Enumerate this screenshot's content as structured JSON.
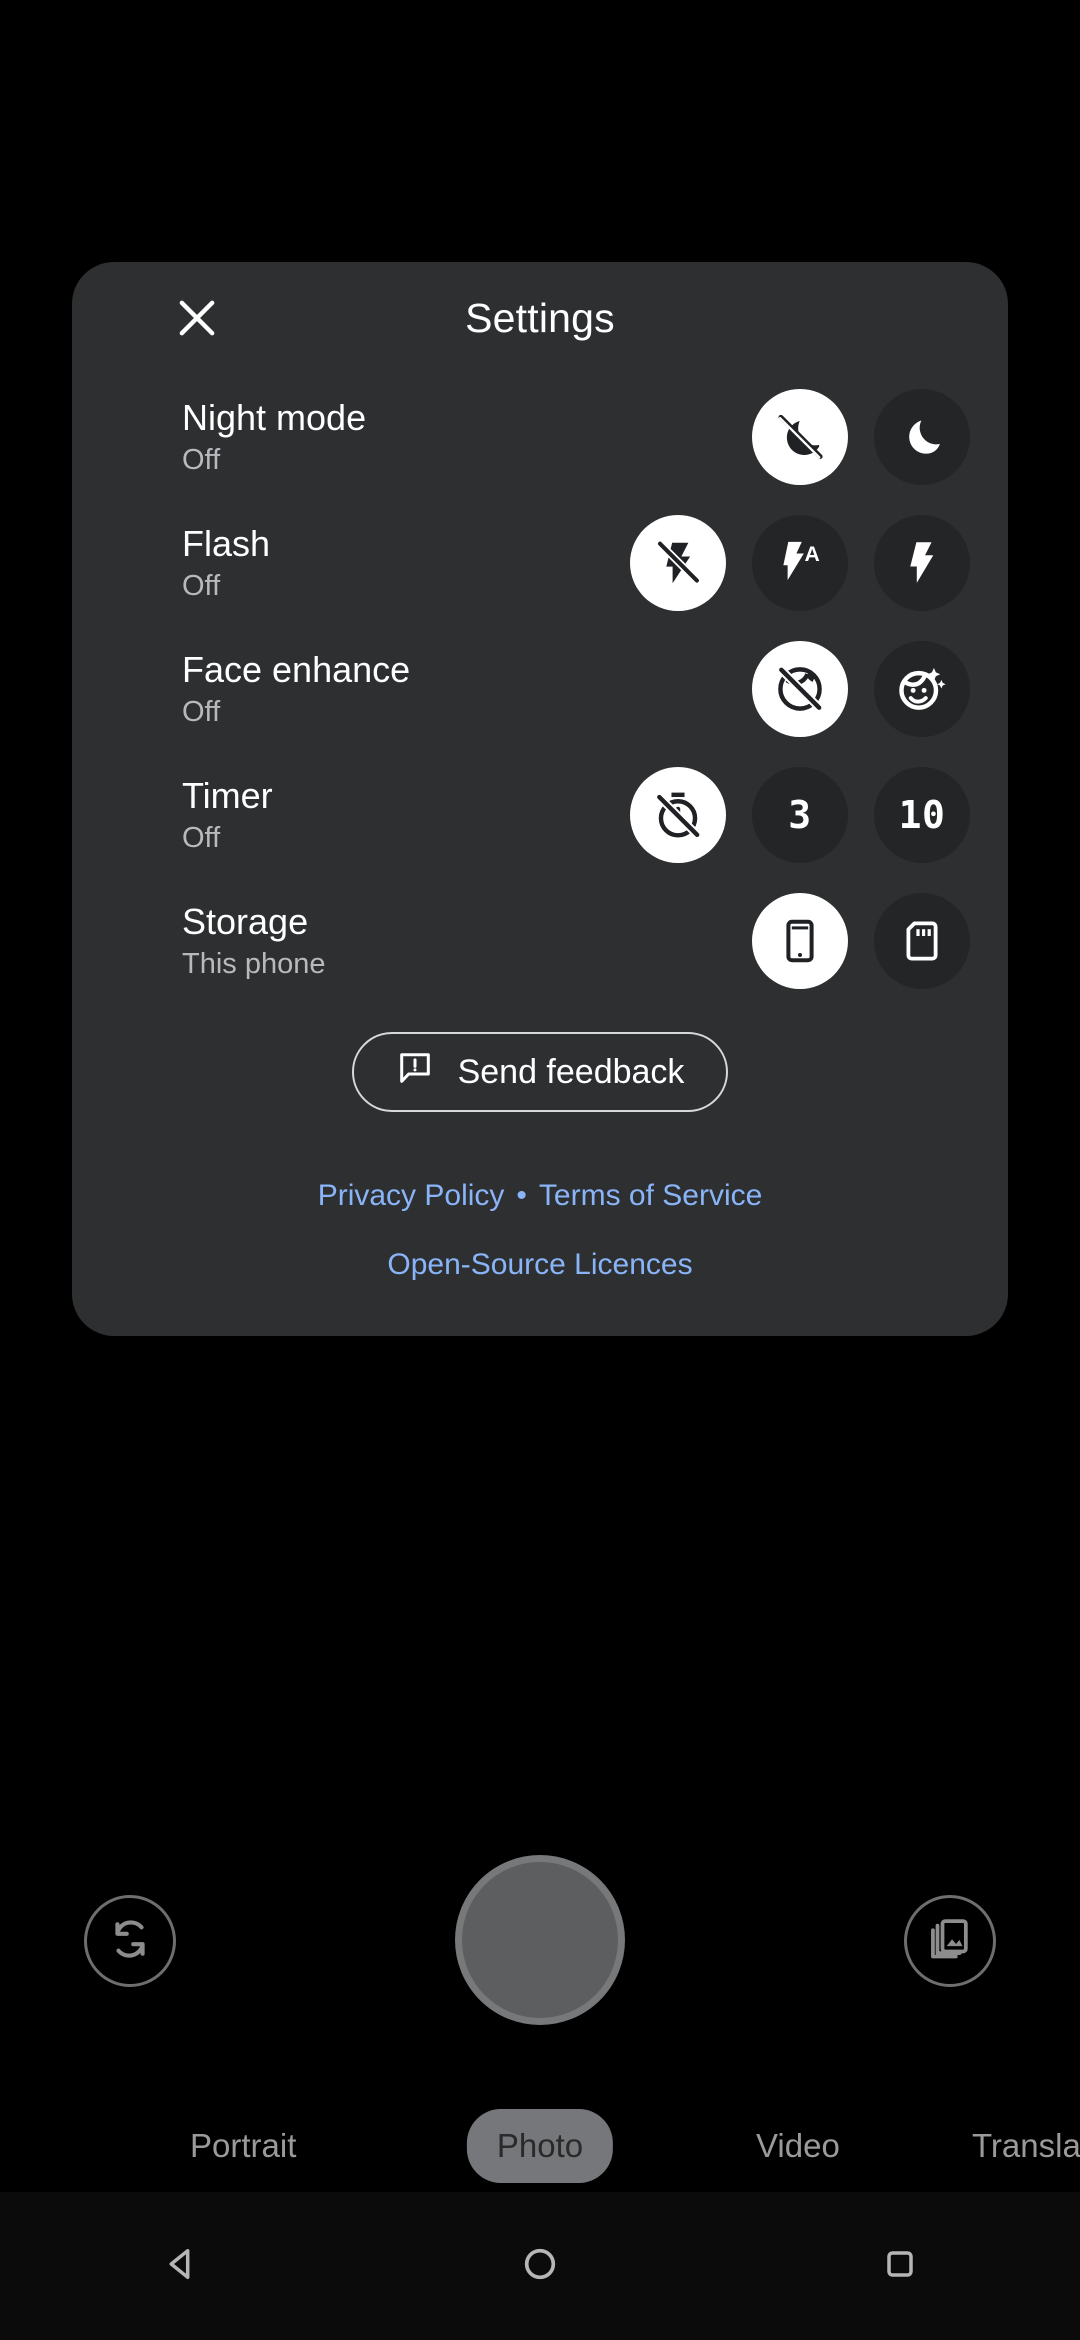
{
  "sheet": {
    "title": "Settings",
    "close_icon": "close-icon",
    "settings": [
      {
        "title": "Night mode",
        "value": "Off",
        "options": [
          {
            "icon": "night-mode-off-icon",
            "label": "",
            "selected": true
          },
          {
            "icon": "moon-icon",
            "label": "",
            "selected": false
          }
        ]
      },
      {
        "title": "Flash",
        "value": "Off",
        "options": [
          {
            "icon": "flash-off-icon",
            "label": "",
            "selected": true
          },
          {
            "icon": "flash-auto-icon",
            "label": "A",
            "selected": false
          },
          {
            "icon": "flash-on-icon",
            "label": "",
            "selected": false
          }
        ]
      },
      {
        "title": "Face enhance",
        "value": "Off",
        "options": [
          {
            "icon": "face-enhance-off-icon",
            "label": "",
            "selected": true
          },
          {
            "icon": "face-retouch-icon",
            "label": "",
            "selected": false
          }
        ]
      },
      {
        "title": "Timer",
        "value": "Off",
        "options": [
          {
            "icon": "timer-off-icon",
            "label": "",
            "selected": true
          },
          {
            "icon": "timer-3s-icon",
            "label": "3",
            "selected": false
          },
          {
            "icon": "timer-10s-icon",
            "label": "10",
            "selected": false
          }
        ]
      },
      {
        "title": "Storage",
        "value": "This phone",
        "options": [
          {
            "icon": "phone-storage-icon",
            "label": "",
            "selected": true
          },
          {
            "icon": "sd-card-icon",
            "label": "",
            "selected": false
          }
        ]
      }
    ],
    "feedback": {
      "label": "Send feedback",
      "icon": "feedback-bubble-icon"
    },
    "legal": {
      "privacy_policy": "Privacy Policy",
      "separator": "•",
      "terms_of_service": "Terms of Service",
      "open_source": "Open-Source Licences",
      "link_color": "#8ab4f8"
    }
  },
  "camera": {
    "switch_camera_icon": "camera-switch-icon",
    "shutter_icon": "shutter-button",
    "gallery_icon": "gallery-icon",
    "modes": [
      {
        "label": "Portrait",
        "active": false
      },
      {
        "label": "Photo",
        "active": true
      },
      {
        "label": "Video",
        "active": false
      },
      {
        "label": "Translate",
        "active": false
      }
    ]
  },
  "navbar": {
    "back_icon": "back-triangle-icon",
    "home_icon": "home-circle-icon",
    "recents_icon": "recents-square-icon"
  }
}
